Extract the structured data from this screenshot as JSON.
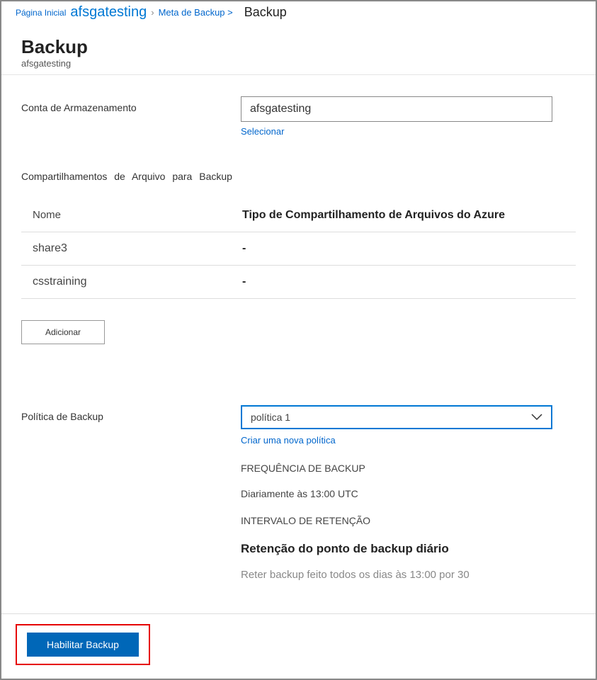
{
  "breadcrumb": {
    "home": "Página Inicial",
    "resource": "afsgatesting",
    "meta": "Meta de Backup >",
    "current": "Backup"
  },
  "header": {
    "title": "Backup",
    "subtitle": "afsgatesting"
  },
  "storage": {
    "label": "Conta de Armazenamento",
    "value": "afsgatesting",
    "select_link": "Selecionar"
  },
  "shares": {
    "title": "Compartilhamentos  de  Arquivo  para  Backup",
    "col_name": "Nome",
    "col_type": "Tipo de Compartilhamento de Arquivos do Azure",
    "rows": [
      {
        "name": "share3",
        "type": "-"
      },
      {
        "name": "csstraining",
        "type": "-"
      }
    ],
    "add_label": "Adicionar"
  },
  "policy": {
    "label": "Política de Backup",
    "selected": "política 1",
    "create_link": "Criar uma nova política",
    "freq_label": "FREQUÊNCIA DE BACKUP",
    "freq_value": "Diariamente às 13:00 UTC",
    "retention_label": "INTERVALO DE RETENÇÃO",
    "retention_title": "Retenção do ponto de backup diário",
    "retention_desc": "Reter backup feito todos os dias às 13:00 por 30"
  },
  "footer": {
    "enable_label": "Habilitar Backup"
  }
}
